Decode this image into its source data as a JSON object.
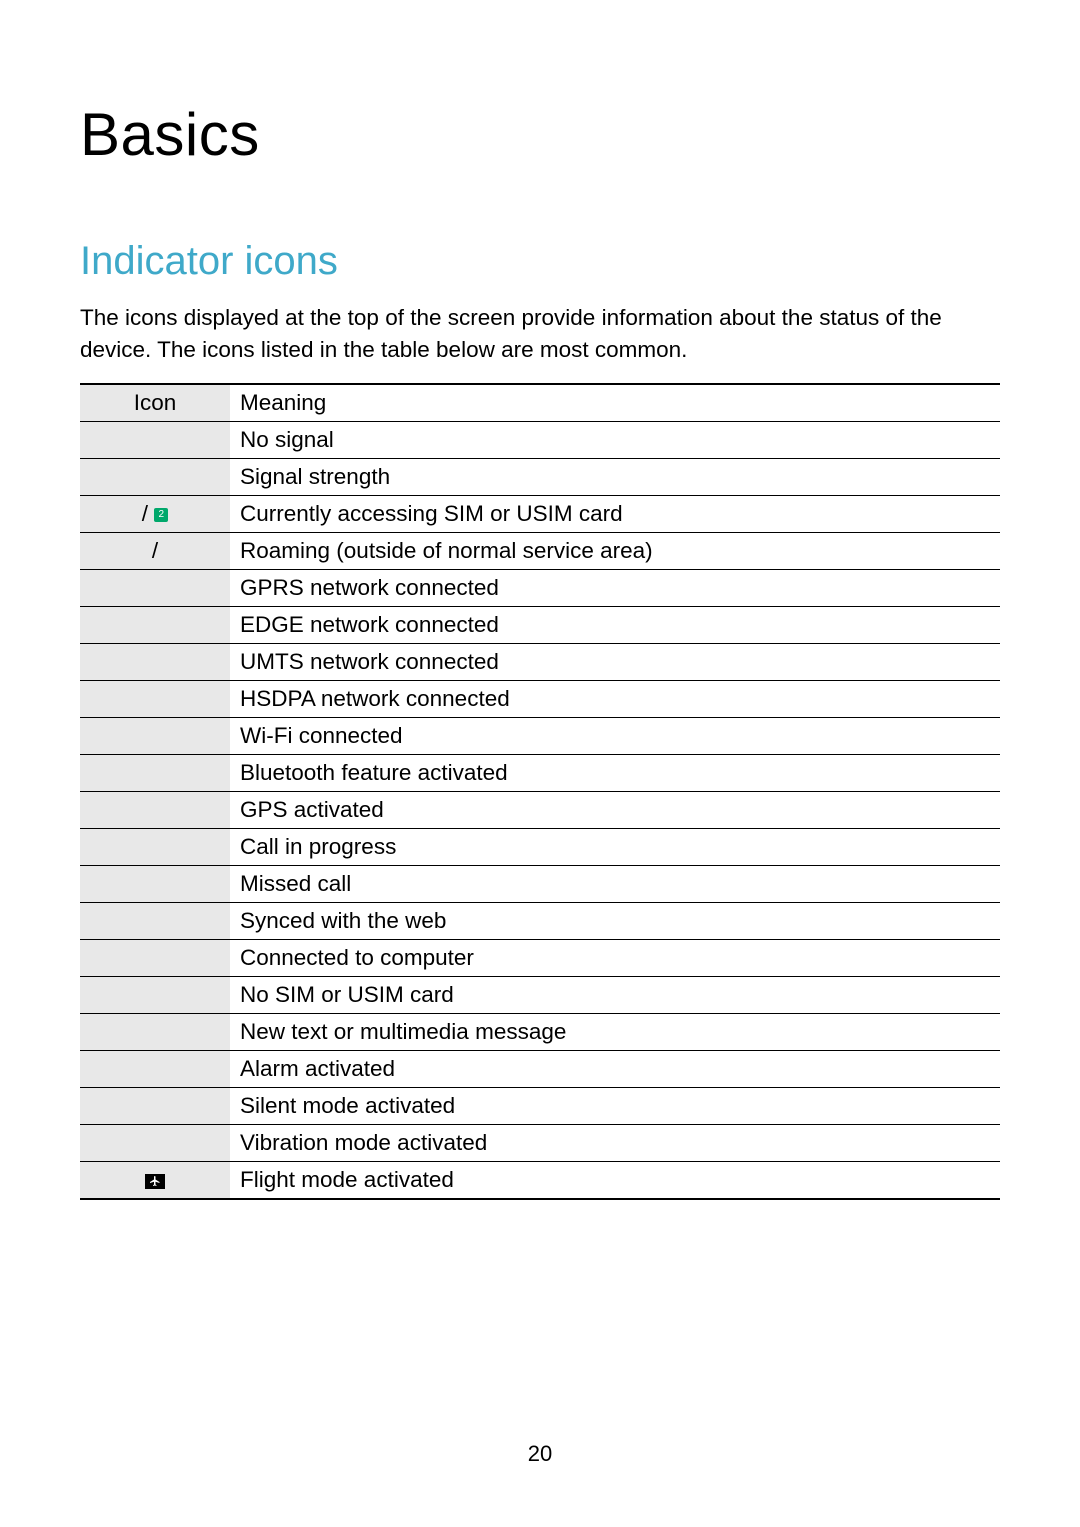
{
  "title": "Basics",
  "section": "Indicator icons",
  "intro": "The icons displayed at the top of the screen provide information about the status of the device. The icons listed in the table below are most common.",
  "table": {
    "header": {
      "icon": "Icon",
      "meaning": "Meaning"
    },
    "rows": [
      {
        "icon": "",
        "meaning": "No signal"
      },
      {
        "icon": "",
        "meaning": "Signal strength"
      },
      {
        "icon": "/",
        "icon_type": "sim",
        "sim_badge": "2",
        "meaning": "Currently accessing SIM or USIM card"
      },
      {
        "icon": "/",
        "meaning": "Roaming (outside of normal service area)"
      },
      {
        "icon": "",
        "meaning": "GPRS network connected"
      },
      {
        "icon": "",
        "meaning": "EDGE network connected"
      },
      {
        "icon": "",
        "meaning": "UMTS network connected"
      },
      {
        "icon": "",
        "meaning": "HSDPA network connected"
      },
      {
        "icon": "",
        "meaning": "Wi-Fi connected"
      },
      {
        "icon": "",
        "meaning": "Bluetooth feature activated"
      },
      {
        "icon": "",
        "meaning": "GPS activated"
      },
      {
        "icon": "",
        "meaning": "Call in progress"
      },
      {
        "icon": "",
        "meaning": "Missed call"
      },
      {
        "icon": "",
        "meaning": "Synced with the web"
      },
      {
        "icon": "",
        "meaning": "Connected to computer"
      },
      {
        "icon": "",
        "meaning": "No SIM or USIM card"
      },
      {
        "icon": "",
        "meaning": "New text or multimedia message"
      },
      {
        "icon": "",
        "meaning": "Alarm activated"
      },
      {
        "icon": "",
        "meaning": "Silent mode activated"
      },
      {
        "icon": "",
        "meaning": "Vibration mode activated"
      },
      {
        "icon": "",
        "icon_type": "flight",
        "meaning": "Flight mode activated"
      }
    ]
  },
  "page_number": "20"
}
